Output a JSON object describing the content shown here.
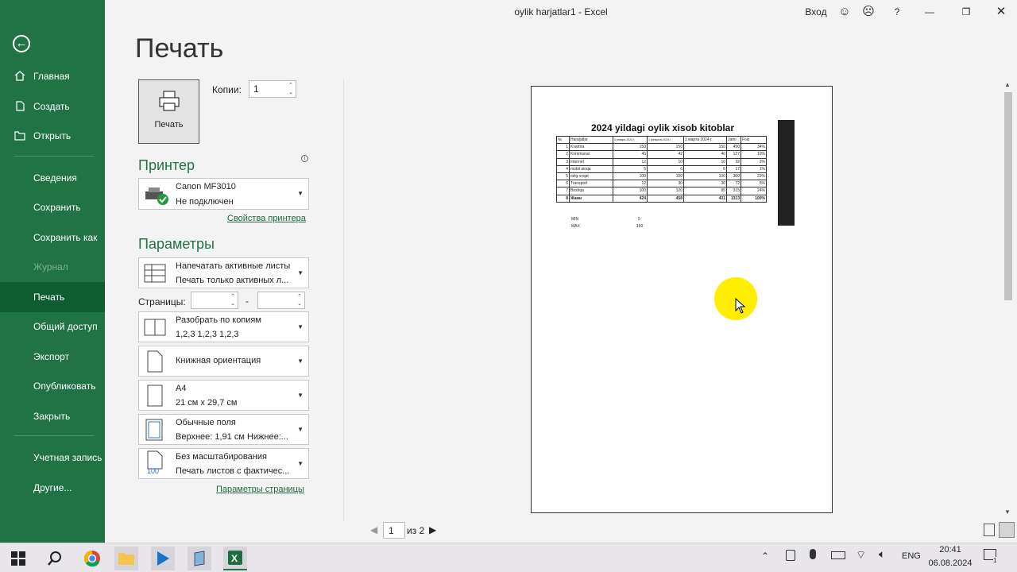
{
  "window": {
    "title": "oylik harjatlar1  -  Excel",
    "signin": "Вход",
    "help": "?"
  },
  "nav": {
    "items": [
      {
        "label": "Главная",
        "icon": "home-icon"
      },
      {
        "label": "Создать",
        "icon": "new-document-icon"
      },
      {
        "label": "Открыть",
        "icon": "folder-open-icon"
      },
      {
        "label": "Сведения"
      },
      {
        "label": "Сохранить"
      },
      {
        "label": "Сохранить как"
      },
      {
        "label": "Журнал",
        "disabled": true
      },
      {
        "label": "Печать",
        "active": true
      },
      {
        "label": "Общий доступ"
      },
      {
        "label": "Экспорт"
      },
      {
        "label": "Опубликовать"
      },
      {
        "label": "Закрыть"
      },
      {
        "label": "Учетная запись"
      },
      {
        "label": "Другие..."
      }
    ]
  },
  "print": {
    "heading": "Печать",
    "button_label": "Печать",
    "copies_label": "Копии:",
    "copies_value": "1",
    "printer_section": "Принтер",
    "printer_name": "Canon MF3010",
    "printer_status": "Не подключен",
    "printer_props_link": "Свойства принтера",
    "params_section": "Параметры",
    "settings": [
      {
        "line1": "Напечатать активные листы",
        "line2": "Печать только активных л..."
      },
      {
        "line1": "Разобрать по копиям",
        "line2": "1,2,3    1,2,3    1,2,3"
      },
      {
        "line1": "Книжная ориентация",
        "line2": ""
      },
      {
        "line1": "A4",
        "line2": "21 см x 29,7 см"
      },
      {
        "line1": "Обычные поля",
        "line2": "Верхнее: 1,91 см Нижнее:..."
      },
      {
        "line1": "Без масштабирования",
        "line2": "Печать листов с фактичес..."
      }
    ],
    "pages_label": "Страницы:",
    "pages_dash": "-",
    "page_setup_link": "Параметры страницы",
    "scale_icon_text": "100"
  },
  "preview": {
    "sheet_title": "2024 yildagi oylik xisob kitoblar",
    "headers": [
      "№",
      "Harajatlar",
      "1 января 2024 г.",
      "1 февраля 2024 г.",
      "1 марта 2024 г.",
      "Jami",
      "Foiz"
    ],
    "rows": [
      [
        "1",
        "Kvartira",
        "150",
        "150",
        "150",
        "450",
        "34%"
      ],
      [
        "2",
        "Kommunal",
        "45",
        "42",
        "40",
        "127",
        "10%"
      ],
      [
        "3",
        "Internet",
        "12",
        "10",
        "10",
        "32",
        "2%"
      ],
      [
        "4",
        "mobil aloqa",
        "5",
        "6",
        "6",
        "17",
        "1%"
      ],
      [
        "5",
        "ozig ovqat",
        "100",
        "100",
        "100",
        "300",
        "23%"
      ],
      [
        "6",
        "Transport",
        "12",
        "30",
        "30",
        "72",
        "5%"
      ],
      [
        "7",
        "Boshqa",
        "100",
        "120",
        "95",
        "315",
        "24%"
      ],
      [
        "8",
        "Жами",
        "424",
        "458",
        "431",
        "1313",
        "100%"
      ]
    ],
    "min_label": "MIN",
    "min_value": "5",
    "max_label": "MAX",
    "max_value": "150",
    "page_current": "1",
    "page_total": "из 2"
  },
  "taskbar": {
    "lang": "ENG",
    "time": "20:41",
    "date": "06.08.2024",
    "notif": "1"
  },
  "colors": {
    "accent": "#217346",
    "active_nav": "#0e5c2f",
    "highlight": "#ffee00"
  }
}
